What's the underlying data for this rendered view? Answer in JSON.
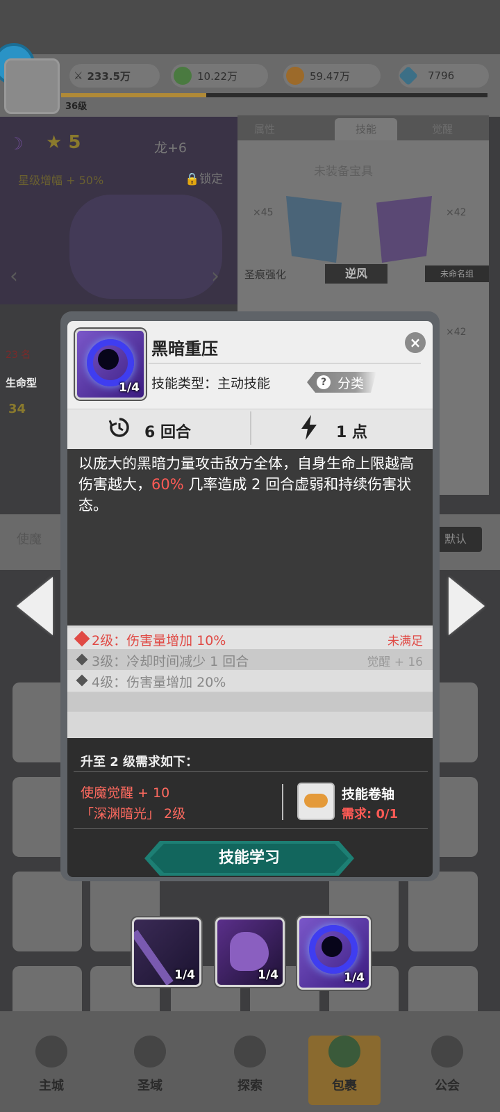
{
  "resources": {
    "power": "233.5万",
    "green": "10.22万",
    "gold": "59.47万",
    "gem": "7796"
  },
  "player": {
    "level": "36级"
  },
  "hero": {
    "stars": "5",
    "dragon": "龙+6",
    "star_bonus": "星级增幅 + 50%",
    "lock": "锁定",
    "rank": "23 名",
    "type": "生命型",
    "power_short": "34"
  },
  "right_tabs": [
    "属性",
    "技能",
    "觉醒"
  ],
  "right_panel": {
    "treasure": "未装备宝具",
    "left_count": "×45",
    "right_count": "×42",
    "enhance": "圣痕强化",
    "wind": "逆风",
    "unnamed": "未命名组",
    "bottom_count": "×42"
  },
  "background_labels": {
    "left_tag": "使魔",
    "default": "默认"
  },
  "nav": [
    "主城",
    "圣域",
    "探索",
    "包裹",
    "公会"
  ],
  "dialog": {
    "skill_name": "黑暗重压",
    "skill_level": "1/4",
    "type_label": "技能类型：",
    "type_value": "主动技能",
    "category": "分类",
    "category_q": "?",
    "close": "×",
    "cooldown": "6 回合",
    "cost": "1 点",
    "desc_a": "以庞大的黑暗力量攻击敌方全体，自身生命上限越高伤害越大，",
    "desc_pct": "60%",
    "desc_b": " 几率造成 2 回合虚弱和持续伤害状态。",
    "levels": [
      {
        "text": "2级：伤害量增加 10%",
        "req": "未满足"
      },
      {
        "text": "3级：冷却时间减少 1 回合",
        "req": "觉醒 + 16"
      },
      {
        "text": "4级：伤害量增加 20%",
        "req": ""
      }
    ],
    "req_title": "升至 2 级需求如下：",
    "req_1": "使魔觉醒 + 10",
    "req_2": "「深渊暗光」 2级",
    "item_name": "技能卷轴",
    "item_need": "需求: 0/1",
    "learn": "技能学习"
  },
  "skill_bar": [
    "1/4",
    "1/4",
    "1/4"
  ],
  "colors": {
    "accent_red": "#ff5a55",
    "teal": "#12665d"
  }
}
